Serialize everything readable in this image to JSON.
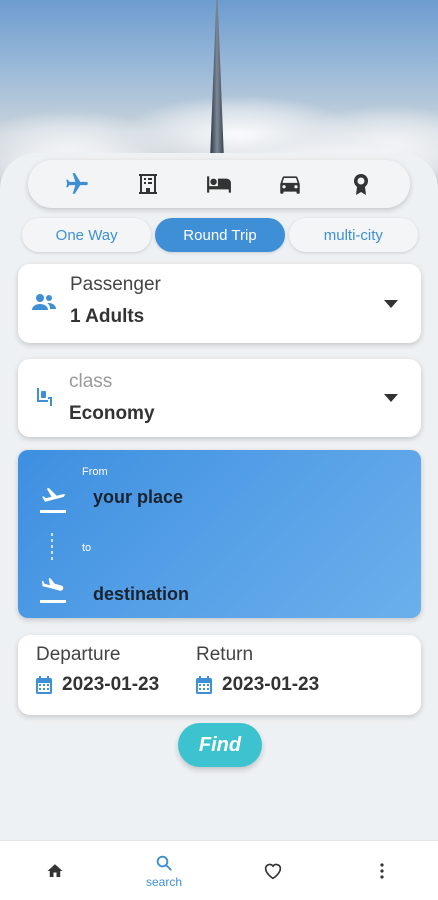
{
  "hero": {
    "image": "sky-tower-clouds"
  },
  "categories": [
    {
      "icon": "plane-icon",
      "active": true
    },
    {
      "icon": "hotel-icon",
      "active": false
    },
    {
      "icon": "bed-icon",
      "active": false
    },
    {
      "icon": "car-icon",
      "active": false
    },
    {
      "icon": "badge-icon",
      "active": false
    }
  ],
  "trip_types": [
    {
      "label": "One Way",
      "active": false
    },
    {
      "label": "Round Trip",
      "active": true
    },
    {
      "label": "multi-city",
      "active": false
    }
  ],
  "passenger": {
    "label": "Passenger",
    "value": "1 Adults"
  },
  "class_field": {
    "placeholder": "class",
    "value": "Economy"
  },
  "route": {
    "from_label": "From",
    "from_value": "your place",
    "to_label": "to",
    "to_value": "destination"
  },
  "dates": {
    "departure_label": "Departure",
    "departure_value": "2023-01-23",
    "return_label": "Return",
    "return_value": "2023-01-23"
  },
  "find_label": "Find",
  "bottom_nav": {
    "search_label": "search"
  },
  "colors": {
    "accent": "#3f8fd6",
    "find": "#3cc3cf",
    "route_start": "#3d8fe0",
    "route_end": "#6ab0ec"
  }
}
